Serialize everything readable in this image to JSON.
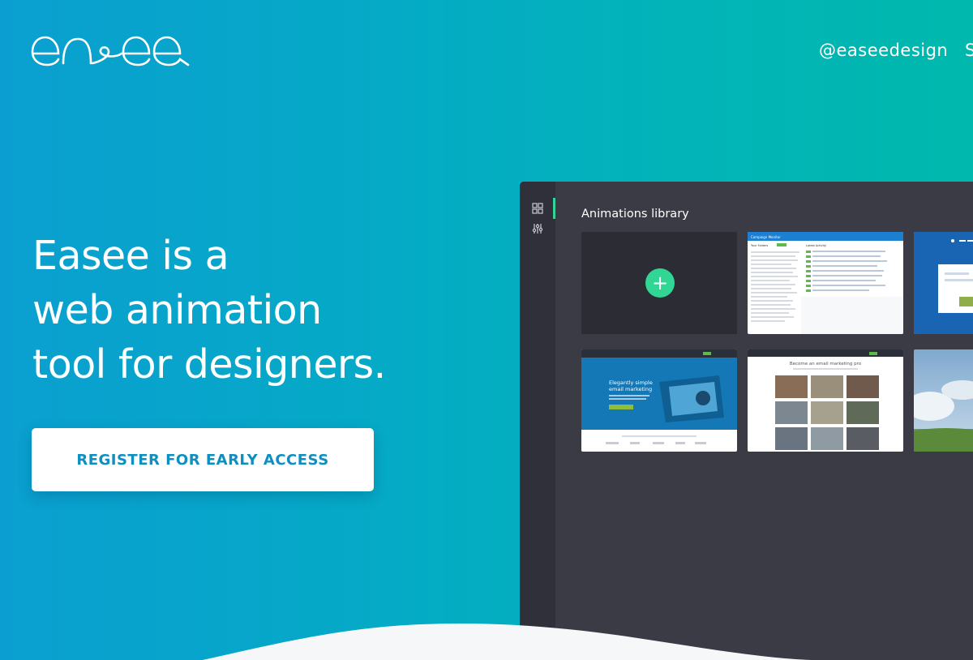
{
  "header": {
    "logo_text": "easee",
    "nav_handle": "@easeedesign",
    "nav_cut": "S"
  },
  "hero": {
    "title_lines": [
      "Easee is a",
      "web animation",
      "tool for designers."
    ],
    "cta_label": "REGISTER FOR EARLY ACCESS"
  },
  "app": {
    "title": "Animations library",
    "add_label": "+",
    "sidebar": {
      "icons": [
        "grid-icon",
        "sliders-icon"
      ]
    },
    "thumbnails": {
      "dashboard": {
        "brand": "Campaign Monitor",
        "left_heading": "Your Folders",
        "right_heading": "Latest Activity"
      },
      "landing": {
        "headline_1": "Elegantly simple",
        "headline_2": "email marketing"
      },
      "grid": {
        "headline": "Become an email marketing pro"
      }
    }
  },
  "colors": {
    "gradient_start": "#0a9fd0",
    "gradient_end": "#00b8ad",
    "cta_text": "#0e8fc2",
    "accent_green": "#31d694",
    "app_bg": "#3a3b45",
    "app_sidebar": "#2f3039"
  }
}
